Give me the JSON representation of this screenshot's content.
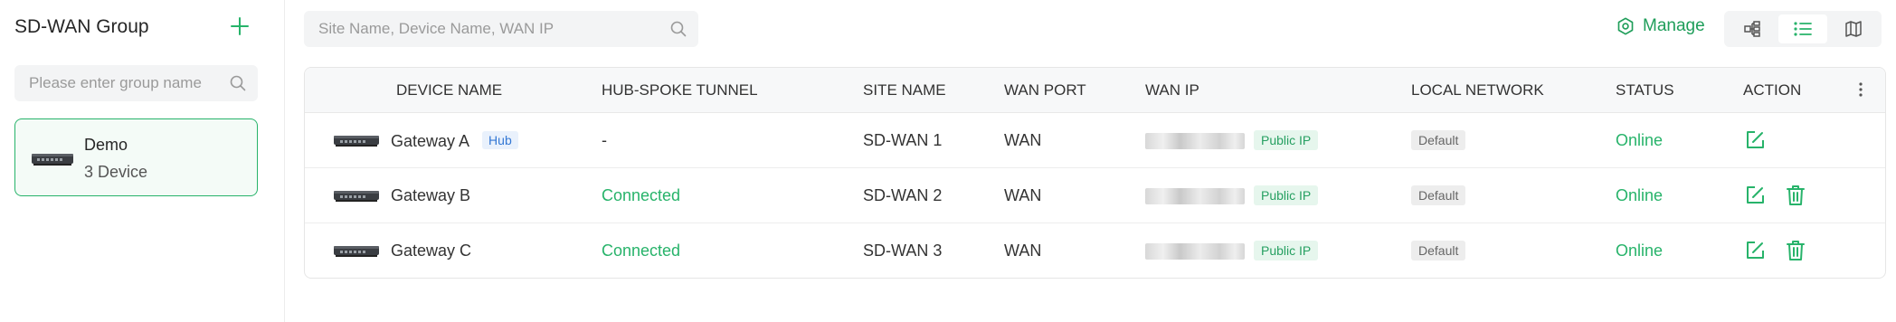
{
  "sidebar": {
    "title": "SD-WAN Group",
    "search_placeholder": "Please enter group name",
    "groups": [
      {
        "name": "Demo",
        "count": "3 Device"
      }
    ]
  },
  "toolbar": {
    "search_placeholder": "Site Name, Device Name, WAN IP",
    "manage_label": "Manage"
  },
  "table": {
    "columns": [
      "DEVICE NAME",
      "HUB-SPOKE TUNNEL",
      "SITE NAME",
      "WAN PORT",
      "WAN IP",
      "LOCAL NETWORK",
      "STATUS",
      "ACTION"
    ],
    "rows": [
      {
        "device": "Gateway A",
        "tag": "Hub",
        "tunnel": "-",
        "site": "SD-WAN 1",
        "port": "WAN",
        "ip_tag": "Public IP",
        "network": "Default",
        "status": "Online"
      },
      {
        "device": "Gateway B",
        "tag": "",
        "tunnel": "Connected",
        "site": "SD-WAN 2",
        "port": "WAN",
        "ip_tag": "Public IP",
        "network": "Default",
        "status": "Online"
      },
      {
        "device": "Gateway C",
        "tag": "",
        "tunnel": "Connected",
        "site": "SD-WAN 3",
        "port": "WAN",
        "ip_tag": "Public IP",
        "network": "Default",
        "status": "Online"
      }
    ]
  },
  "colors": {
    "accent": "#27b36a",
    "tag_blue": "#3478d4"
  },
  "icons": [
    "plus-icon",
    "search-icon",
    "manage-gear-icon",
    "topology-view-icon",
    "list-view-icon",
    "map-view-icon",
    "more-icon",
    "edit-icon",
    "delete-icon",
    "gateway-device-icon"
  ]
}
